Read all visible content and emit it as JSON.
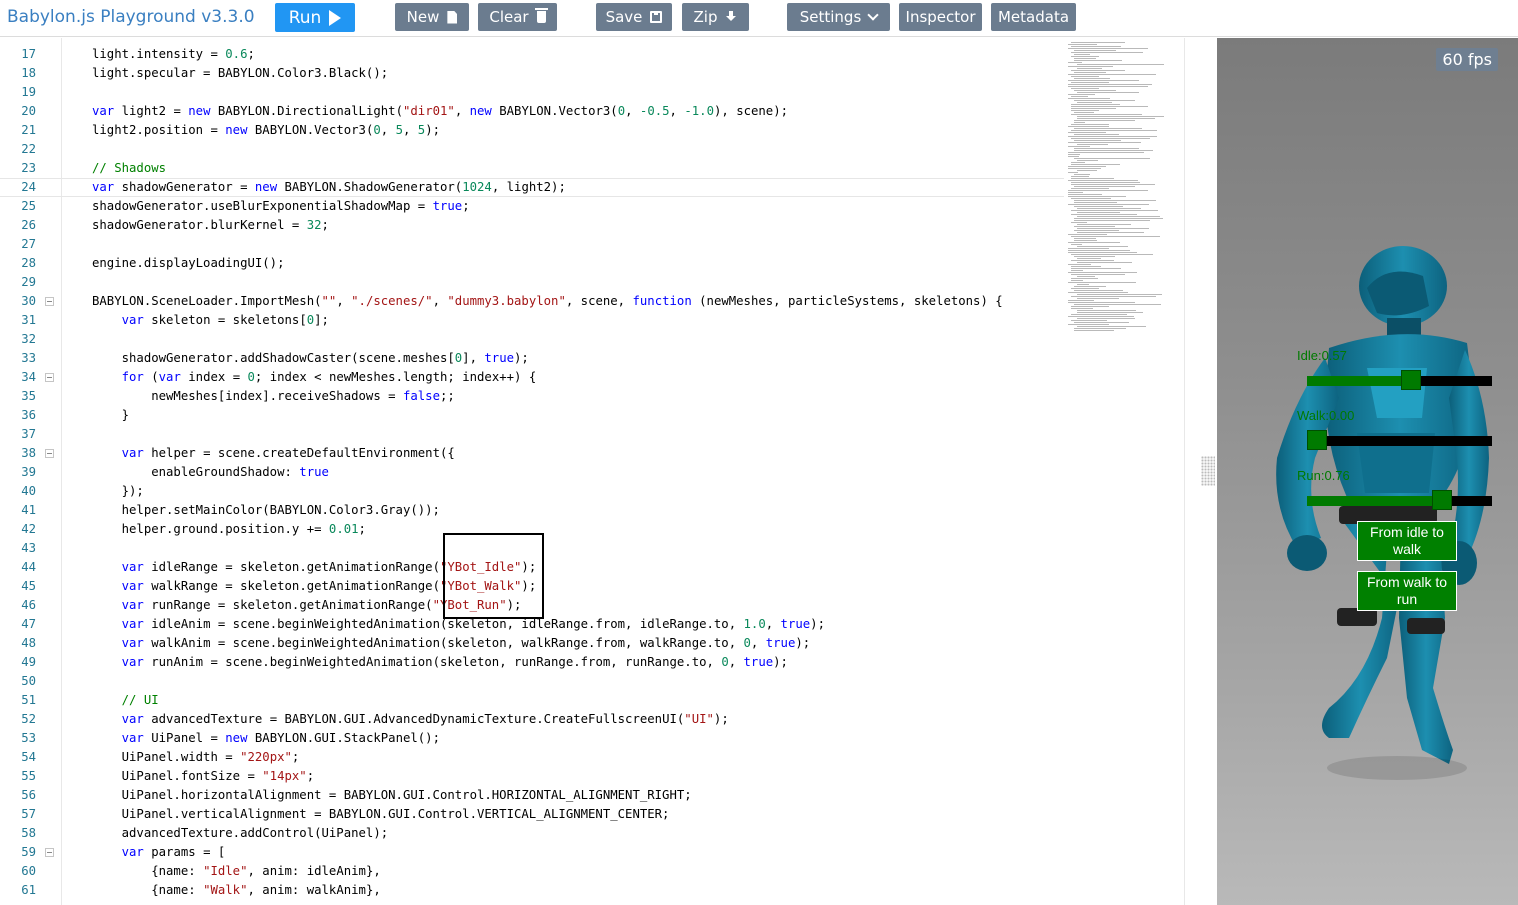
{
  "app": {
    "title": "Babylon.js Playground v3.3.0"
  },
  "toolbar": {
    "run": "Run",
    "new": "New",
    "clear": "Clear",
    "save": "Save",
    "zip": "Zip",
    "settings": "Settings",
    "inspector": "Inspector",
    "metadata": "Metadata"
  },
  "editor": {
    "current_line": 24,
    "lines": [
      {
        "n": 17,
        "html": "light.intensity = <span class=\"num\">0.6</span>;"
      },
      {
        "n": 18,
        "html": "light.specular = BABYLON.Color3.Black();"
      },
      {
        "n": 19,
        "html": ""
      },
      {
        "n": 20,
        "html": "<span class=\"kw\">var</span> light2 = <span class=\"kw\">new</span> BABYLON.DirectionalLight(<span class=\"str\">\"dir01\"</span>, <span class=\"kw\">new</span> BABYLON.Vector3(<span class=\"num\">0</span>, <span class=\"num\">-0.5</span>, <span class=\"num\">-1.0</span>), scene);"
      },
      {
        "n": 21,
        "html": "light2.position = <span class=\"kw\">new</span> BABYLON.Vector3(<span class=\"num\">0</span>, <span class=\"num\">5</span>, <span class=\"num\">5</span>);"
      },
      {
        "n": 22,
        "html": ""
      },
      {
        "n": 23,
        "html": "<span class=\"cm\">// Shadows</span>"
      },
      {
        "n": 24,
        "html": "<span class=\"kw\">var</span> shadowGenerator = <span class=\"kw\">new</span> BABYLON.ShadowGenerator(<span class=\"num\">1024</span>, light2);"
      },
      {
        "n": 25,
        "html": "shadowGenerator.useBlurExponentialShadowMap = <span class=\"kw\">true</span>;"
      },
      {
        "n": 26,
        "html": "shadowGenerator.blurKernel = <span class=\"num\">32</span>;"
      },
      {
        "n": 27,
        "html": ""
      },
      {
        "n": 28,
        "html": "engine.displayLoadingUI();"
      },
      {
        "n": 29,
        "html": ""
      },
      {
        "n": 30,
        "fold": true,
        "html": "BABYLON.SceneLoader.ImportMesh(<span class=\"str\">\"\"</span>, <span class=\"str\">\"./scenes/\"</span>, <span class=\"str\">\"dummy3.babylon\"</span>, scene, <span class=\"kw\">function</span> (newMeshes, particleSystems, skeletons) {"
      },
      {
        "n": 31,
        "html": "    <span class=\"kw\">var</span> skeleton = skeletons[<span class=\"num\">0</span>];"
      },
      {
        "n": 32,
        "html": ""
      },
      {
        "n": 33,
        "html": "    shadowGenerator.addShadowCaster(scene.meshes[<span class=\"num\">0</span>], <span class=\"kw\">true</span>);"
      },
      {
        "n": 34,
        "fold": true,
        "html": "    <span class=\"kw\">for</span> (<span class=\"kw\">var</span> index = <span class=\"num\">0</span>; index &lt; newMeshes.length; index++) {"
      },
      {
        "n": 35,
        "html": "        newMeshes[index].receiveShadows = <span class=\"kw\">false</span>;;"
      },
      {
        "n": 36,
        "html": "    }"
      },
      {
        "n": 37,
        "html": ""
      },
      {
        "n": 38,
        "fold": true,
        "html": "    <span class=\"kw\">var</span> helper = scene.createDefaultEnvironment({"
      },
      {
        "n": 39,
        "html": "        enableGroundShadow: <span class=\"kw\">true</span>"
      },
      {
        "n": 40,
        "html": "    });"
      },
      {
        "n": 41,
        "html": "    helper.setMainColor(BABYLON.Color3.Gray());"
      },
      {
        "n": 42,
        "html": "    helper.ground.position.y += <span class=\"num\">0.01</span>;"
      },
      {
        "n": 43,
        "html": ""
      },
      {
        "n": 44,
        "html": "    <span class=\"kw\">var</span> idleRange = skeleton.getAnimationRange(<span class=\"str\">\"YBot_Idle\"</span>);"
      },
      {
        "n": 45,
        "html": "    <span class=\"kw\">var</span> walkRange = skeleton.getAnimationRange(<span class=\"str\">\"YBot_Walk\"</span>);"
      },
      {
        "n": 46,
        "html": "    <span class=\"kw\">var</span> runRange = skeleton.getAnimationRange(<span class=\"str\">\"YBot_Run\"</span>);"
      },
      {
        "n": 47,
        "html": "    <span class=\"kw\">var</span> idleAnim = scene.beginWeightedAnimation(skeleton, idleRange.from, idleRange.to, <span class=\"num\">1.0</span>, <span class=\"kw\">true</span>);"
      },
      {
        "n": 48,
        "html": "    <span class=\"kw\">var</span> walkAnim = scene.beginWeightedAnimation(skeleton, walkRange.from, walkRange.to, <span class=\"num\">0</span>, <span class=\"kw\">true</span>);"
      },
      {
        "n": 49,
        "html": "    <span class=\"kw\">var</span> runAnim = scene.beginWeightedAnimation(skeleton, runRange.from, runRange.to, <span class=\"num\">0</span>, <span class=\"kw\">true</span>);"
      },
      {
        "n": 50,
        "html": ""
      },
      {
        "n": 51,
        "html": "    <span class=\"cm\">// UI</span>"
      },
      {
        "n": 52,
        "html": "    <span class=\"kw\">var</span> advancedTexture = BABYLON.GUI.AdvancedDynamicTexture.CreateFullscreenUI(<span class=\"str\">\"UI\"</span>);"
      },
      {
        "n": 53,
        "html": "    <span class=\"kw\">var</span> UiPanel = <span class=\"kw\">new</span> BABYLON.GUI.StackPanel();"
      },
      {
        "n": 54,
        "html": "    UiPanel.width = <span class=\"str\">\"220px\"</span>;"
      },
      {
        "n": 55,
        "html": "    UiPanel.fontSize = <span class=\"str\">\"14px\"</span>;"
      },
      {
        "n": 56,
        "html": "    UiPanel.horizontalAlignment = BABYLON.GUI.Control.HORIZONTAL_ALIGNMENT_RIGHT;"
      },
      {
        "n": 57,
        "html": "    UiPanel.verticalAlignment = BABYLON.GUI.Control.VERTICAL_ALIGNMENT_CENTER;"
      },
      {
        "n": 58,
        "html": "    advancedTexture.addControl(UiPanel);"
      },
      {
        "n": 59,
        "fold": true,
        "html": "    <span class=\"kw\">var</span> params = ["
      },
      {
        "n": 60,
        "html": "        {name: <span class=\"str\">\"Idle\"</span>, anim: idleAnim},"
      },
      {
        "n": 61,
        "html": "        {name: <span class=\"str\">\"Walk\"</span>, anim: walkAnim},"
      }
    ]
  },
  "viewport": {
    "fps": "60 fps",
    "sliders": [
      {
        "label": "Idle:0.57",
        "value": 0.57
      },
      {
        "label": "Walk:0.00",
        "value": 0.0
      },
      {
        "label": "Run:0.76",
        "value": 0.76
      }
    ],
    "buttons": [
      {
        "label": "From idle to walk"
      },
      {
        "label": "From walk to run"
      }
    ],
    "colors": {
      "robot": "#1d8fb0",
      "gui_green": "#008000"
    }
  }
}
